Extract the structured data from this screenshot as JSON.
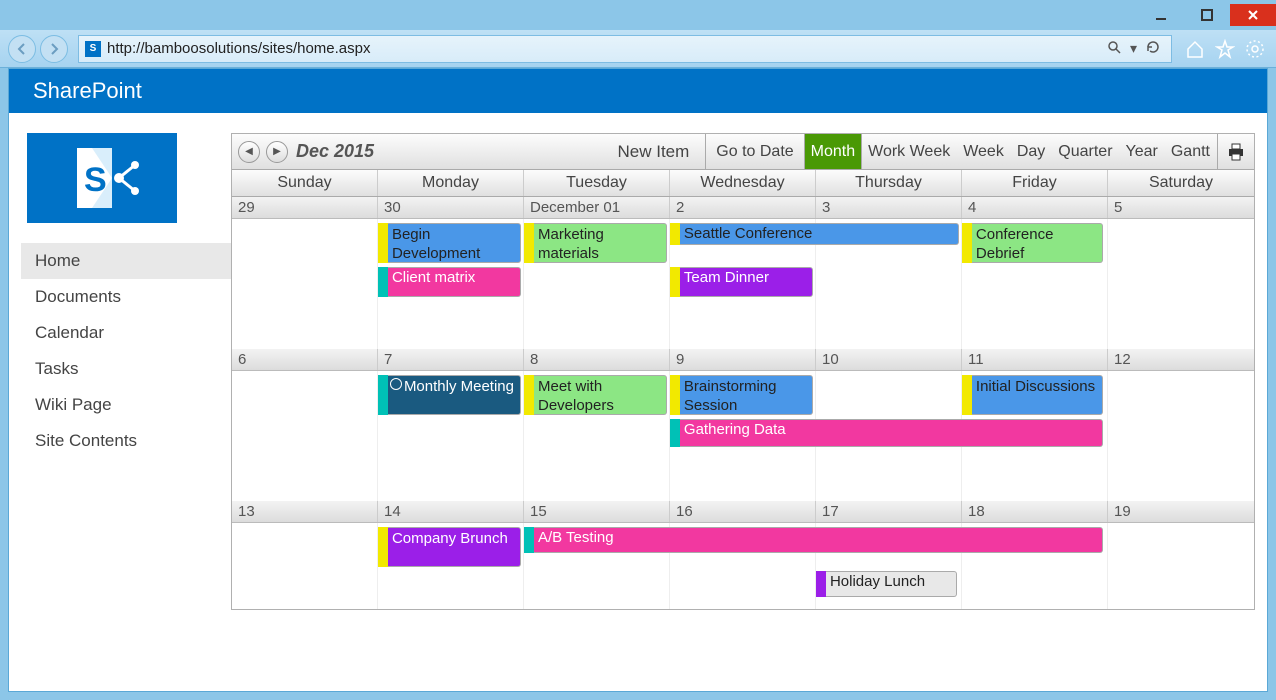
{
  "browser": {
    "url": "http://bamboosolutions/sites/home.aspx"
  },
  "sp": {
    "brand": "SharePoint"
  },
  "nav": {
    "items": [
      "Home",
      "Documents",
      "Calendar",
      "Tasks",
      "Wiki Page",
      "Site Contents"
    ],
    "active": "Home"
  },
  "calendar": {
    "period": "Dec 2015",
    "new_item": "New Item",
    "views": {
      "go_to_date": "Go to Date",
      "month": "Month",
      "work_week": "Work Week",
      "week": "Week",
      "day": "Day",
      "quarter": "Quarter",
      "year": "Year",
      "gantt": "Gantt"
    },
    "active_view": "Month",
    "day_headers": [
      "Sunday",
      "Monday",
      "Tuesday",
      "Wednesday",
      "Thursday",
      "Friday",
      "Saturday"
    ],
    "weeks": [
      {
        "dates": [
          "29",
          "30",
          "December 01",
          "2",
          "3",
          "4",
          "5"
        ]
      },
      {
        "dates": [
          "6",
          "7",
          "8",
          "9",
          "10",
          "11",
          "12"
        ]
      },
      {
        "dates": [
          "13",
          "14",
          "15",
          "16",
          "17",
          "18",
          "19"
        ]
      }
    ],
    "events": {
      "begin_development": "Begin Development",
      "marketing_materials": "Marketing materials",
      "seattle_conference": "Seattle Conference",
      "conference_debrief": "Conference Debrief",
      "client_matrix": "Client matrix",
      "team_dinner": "Team Dinner",
      "monthly_meeting": "Monthly Meeting",
      "meet_with_developers": "Meet with Developers",
      "brainstorming_session": "Brainstorming Session",
      "initial_discussions": "Initial Discussions",
      "gathering_data": "Gathering Data",
      "company_brunch": "Company Brunch",
      "ab_testing": "A/B Testing",
      "holiday_lunch": "Holiday Lunch"
    },
    "colors": {
      "blue": "#4a97e8",
      "green": "#8ce684",
      "yellow": "#f2e900",
      "pink": "#f238a0",
      "purple": "#9b1fe8",
      "teal": "#00c1b6",
      "navy": "#1a5a80",
      "ltgray": "#e8e8e8"
    }
  }
}
